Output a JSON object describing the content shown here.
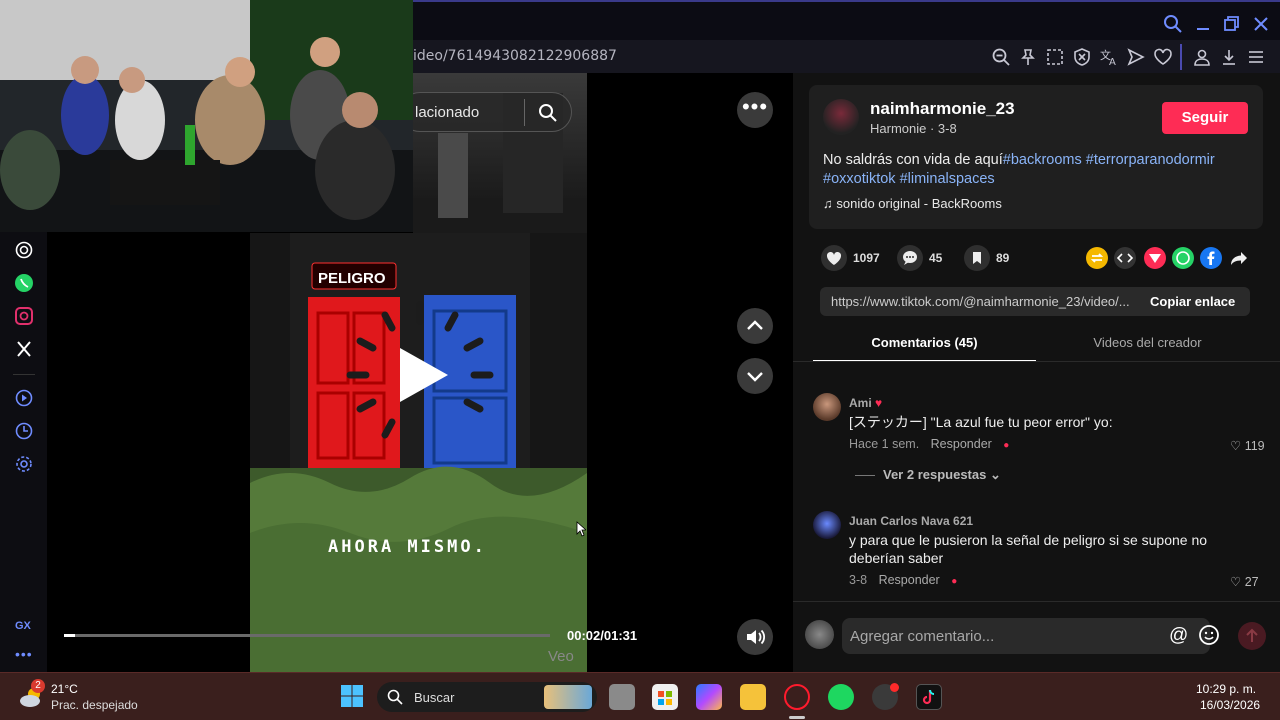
{
  "browser": {
    "url": "ideo/7614943082122906887"
  },
  "video": {
    "search_text": "lacionado",
    "more_label": "•••",
    "time": "00:02/01:31",
    "progress": 0.022,
    "watermark": "Veo",
    "sign_text": "PELIGRO",
    "caption": "AHORA MISMO."
  },
  "author": {
    "username": "naimharmonie_23",
    "subline": "Harmonie · 3-8",
    "follow_label": "Seguir",
    "desc_text": "No saldrás con vida de aquí",
    "tags": [
      "#backrooms",
      "#terrorparanodormir",
      "#oxxotiktok",
      "#liminalspaces"
    ],
    "sound": "♫  sonido original - BackRooms"
  },
  "stats": {
    "likes": "1097",
    "comments": "45",
    "saves": "89"
  },
  "share": {
    "link": "https://www.tiktok.com/@naimharmonie_23/video/...",
    "copy_label": "Copiar enlace"
  },
  "tabs": {
    "comments": "Comentarios (45)",
    "videos": "Videos del creador"
  },
  "comments": [
    {
      "user": "Ami",
      "text": "[ステッカー] \"La azul fue tu peor error\" yo:",
      "time": "Hace 1 sem.",
      "reply": "Responder",
      "likes": "119",
      "view_replies": "Ver 2 respuestas"
    },
    {
      "user": "Juan Carlos Nava 621",
      "text": "y para que le pusieron la señal de peligro si se supone no deberían saber",
      "time": "3-8",
      "reply": "Responder",
      "likes": "27"
    }
  ],
  "comment_input": {
    "placeholder": "Agregar comentario..."
  },
  "taskbar": {
    "weather_badge": "2",
    "temp": "21°C",
    "weather": "Prac. despejado",
    "search": "Buscar",
    "time": "10:29 p. m.",
    "date": "16/03/2026"
  },
  "sidebar": {
    "gx_label": "GX",
    "more_label": "•••"
  },
  "colors": {
    "accent": "#fe2c55",
    "opera_blue": "#6f8cff",
    "taskbar": "#3a1f1d"
  }
}
